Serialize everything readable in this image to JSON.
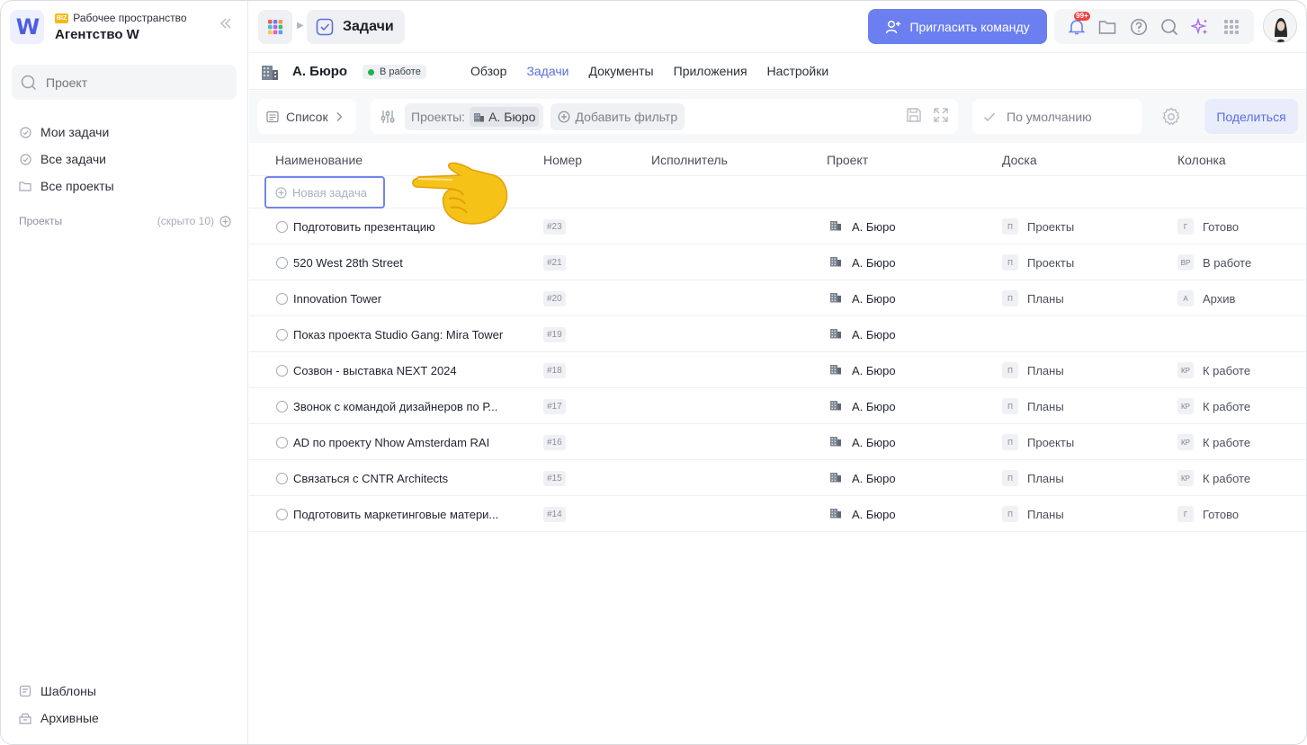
{
  "workspace": {
    "badge": "BIZ",
    "label": "Рабочее пространство",
    "name": "Агентство W",
    "logo": "W"
  },
  "sidebar": {
    "search_placeholder": "Проект",
    "nav": [
      {
        "label": "Мои задачи",
        "icon": "check-circle-icon"
      },
      {
        "label": "Все задачи",
        "icon": "check-circle-icon"
      },
      {
        "label": "Все проекты",
        "icon": "folder-icon"
      }
    ],
    "projects_section": {
      "title": "Проекты",
      "hidden": "(скрыто 10)"
    },
    "bottom": [
      {
        "label": "Шаблоны",
        "icon": "templates-icon"
      },
      {
        "label": "Архивные",
        "icon": "archive-icon"
      }
    ]
  },
  "topbar": {
    "breadcrumb": "Задачи",
    "invite_label": "Пригласить команду",
    "notifications_badge": "99+"
  },
  "project": {
    "name": "А. Бюро",
    "status": "В работе",
    "status_color": "#22b24c",
    "tabs": [
      "Обзор",
      "Задачи",
      "Документы",
      "Приложения",
      "Настройки"
    ],
    "active_tab": "Задачи"
  },
  "filters": {
    "view": "Список",
    "chip_label": "Проекты:",
    "chip_value": "А. Бюро",
    "add_filter": "Добавить фильтр",
    "sort": "По умолчанию",
    "share": "Поделиться"
  },
  "table": {
    "columns": [
      "Наименование",
      "Номер",
      "Исполнитель",
      "Проект",
      "Доска",
      "Колонка"
    ],
    "new_task": "Новая задача",
    "rows": [
      {
        "name": "Подготовить презентацию",
        "num": "#23",
        "project": "А. Бюро",
        "board_tag": "П",
        "board": "Проекты",
        "col_tag": "Г",
        "col": "Готово"
      },
      {
        "name": "520 West 28th Street",
        "num": "#21",
        "project": "А. Бюро",
        "board_tag": "П",
        "board": "Проекты",
        "col_tag": "ВР",
        "col": "В работе"
      },
      {
        "name": "Innovation Tower",
        "num": "#20",
        "project": "А. Бюро",
        "board_tag": "П",
        "board": "Планы",
        "col_tag": "А",
        "col": "Архив"
      },
      {
        "name": "Показ проекта Studio Gang: Mira Tower",
        "num": "#19",
        "project": "А. Бюро",
        "board_tag": "",
        "board": "",
        "col_tag": "",
        "col": ""
      },
      {
        "name": "Созвон - выставка NEXT 2024",
        "num": "#18",
        "project": "А. Бюро",
        "board_tag": "П",
        "board": "Планы",
        "col_tag": "КР",
        "col": "К работе"
      },
      {
        "name": "Звонок с командой дизайнеров по Р...",
        "num": "#17",
        "project": "А. Бюро",
        "board_tag": "П",
        "board": "Планы",
        "col_tag": "КР",
        "col": "К работе"
      },
      {
        "name": "AD по проекту Nhow Amsterdam RAI",
        "num": "#16",
        "project": "А. Бюро",
        "board_tag": "П",
        "board": "Проекты",
        "col_tag": "КР",
        "col": "К работе"
      },
      {
        "name": "Связаться с CNTR Architects",
        "num": "#15",
        "project": "А. Бюро",
        "board_tag": "П",
        "board": "Планы",
        "col_tag": "КР",
        "col": "К работе"
      },
      {
        "name": "Подготовить маркетинговые матери...",
        "num": "#14",
        "project": "А. Бюро",
        "board_tag": "П",
        "board": "Планы",
        "col_tag": "Г",
        "col": "Готово"
      }
    ]
  },
  "colors": {
    "accent": "#6b7ff0",
    "active_tab": "#5b6ee0",
    "status": "#22b24c",
    "badge": "#ef4444"
  }
}
